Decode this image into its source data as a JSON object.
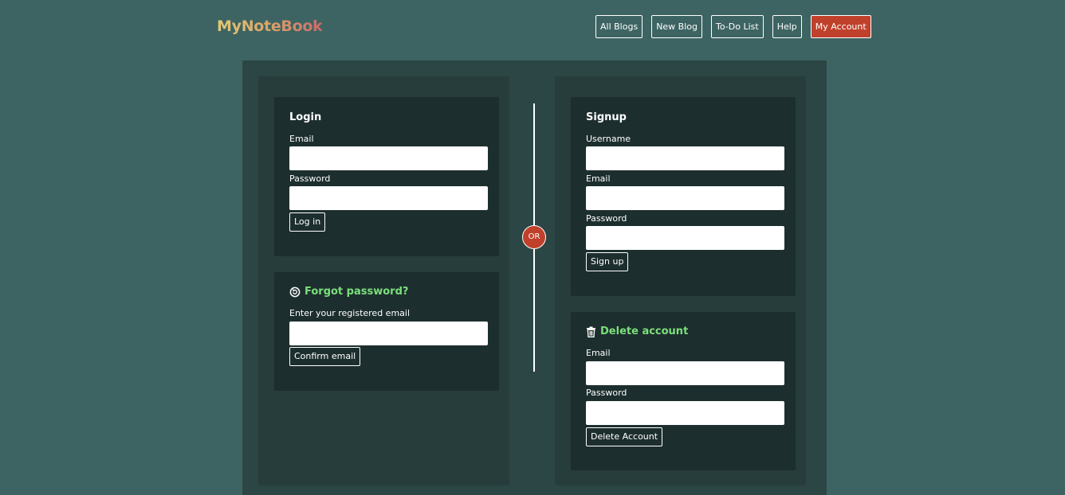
{
  "brand": {
    "logo": "MyNoteBook"
  },
  "nav": {
    "items": [
      "All Blogs",
      "New Blog",
      "To-Do List",
      "Help",
      "My Account"
    ],
    "active": "My Account"
  },
  "login": {
    "title": "Login",
    "email_label": "Email",
    "password_label": "Password",
    "submit_label": "Log in"
  },
  "forgot": {
    "title": "Forgot password?",
    "icon": "reset-password-icon",
    "email_label": "Enter your registered email",
    "submit_label": "Confirm email"
  },
  "separator": {
    "label": "OR"
  },
  "signup": {
    "title": "Signup",
    "username_label": "Username",
    "email_label": "Email",
    "password_label": "Password",
    "submit_label": "Sign up"
  },
  "delete": {
    "title": "Delete account",
    "icon": "trash-icon",
    "email_label": "Email",
    "password_label": "Password",
    "submit_label": "Delete Account"
  },
  "colors": {
    "background": "#3d6462",
    "panel": "#2b4644",
    "column": "#273d3c",
    "card": "#1d2e2e",
    "accent": "#c0412b",
    "highlight": "#7be07b"
  }
}
